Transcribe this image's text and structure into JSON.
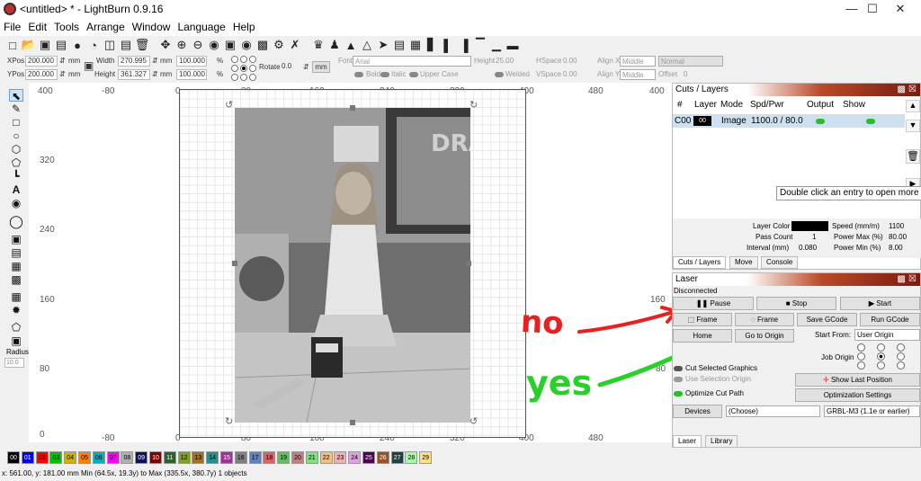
{
  "window": {
    "title": "<untitled> * - LightBurn 0.9.16",
    "minimize": "—",
    "maximize": "☐",
    "close": "✕"
  },
  "menu": [
    "File",
    "Edit",
    "Tools",
    "Arrange",
    "Window",
    "Language",
    "Help"
  ],
  "toolbar2": {
    "xpos_label": "XPos",
    "xpos": "200.000",
    "ypos_label": "YPos",
    "ypos": "200.000",
    "mm": "mm",
    "width_label": "Width",
    "width": "270.995",
    "height_label": "Height",
    "height": "361.327",
    "scale_w": "100.000",
    "scale_h": "100.000",
    "pct": "%",
    "rotate_label": "Rotate",
    "rotate": "0.0",
    "font_label": "Font",
    "font": "Arial",
    "height2_label": "Height",
    "height2": "25.00",
    "hspace_label": "HSpace",
    "hspace": "0.00",
    "vspace_label": "VSpace",
    "vspace": "0.00",
    "alignx_label": "Align X",
    "alignx": "Middle",
    "aligny_label": "Align Y",
    "aligny": "Middle",
    "normal": "Normal",
    "offset_label": "Offset",
    "offset": "0",
    "bold": "Bold",
    "italic": "Italic",
    "upper": "Upper Case",
    "welded": "Welded"
  },
  "left_tools": {
    "radius_label": "Radius:",
    "radius": "10.0"
  },
  "ruler_top": [
    "-80",
    "0",
    "80",
    "160",
    "240",
    "320",
    "400",
    "480",
    "400"
  ],
  "ruler_top_bottom": [
    "-80",
    "0",
    "80",
    "160",
    "240",
    "320",
    "400",
    "480"
  ],
  "ruler_left": [
    "400",
    "320",
    "240",
    "160",
    "80",
    "0"
  ],
  "ruler_right": [
    "400",
    "160",
    "80"
  ],
  "photo_text": "DRA",
  "color_swatches": [
    {
      "label": "00",
      "color": "#000000",
      "text": "#ffffff"
    },
    {
      "label": "01",
      "color": "#0000ff",
      "text": "#ffffff"
    },
    {
      "label": "02",
      "color": "#ff0000",
      "text": "#000000"
    },
    {
      "label": "03",
      "color": "#00c000",
      "text": "#000000"
    },
    {
      "label": "04",
      "color": "#d0b000",
      "text": "#000000"
    },
    {
      "label": "05",
      "color": "#ff8000",
      "text": "#000000"
    },
    {
      "label": "06",
      "color": "#00b0c0",
      "text": "#000000"
    },
    {
      "label": "07",
      "color": "#ff00ff",
      "text": "#000000"
    },
    {
      "label": "08",
      "color": "#b0b0b0",
      "text": "#000000"
    },
    {
      "label": "09",
      "color": "#101060",
      "text": "#ffffff"
    },
    {
      "label": "10",
      "color": "#800000",
      "text": "#ffffff"
    },
    {
      "label": "11",
      "color": "#306030",
      "text": "#ffffff"
    },
    {
      "label": "12",
      "color": "#80a020",
      "text": "#000000"
    },
    {
      "label": "13",
      "color": "#a07020",
      "text": "#000000"
    },
    {
      "label": "14",
      "color": "#209090",
      "text": "#000000"
    },
    {
      "label": "15",
      "color": "#a030a0",
      "text": "#ffffff"
    },
    {
      "label": "16",
      "color": "#808080",
      "text": "#000000"
    },
    {
      "label": "17",
      "color": "#6080c0",
      "text": "#000000"
    },
    {
      "label": "18",
      "color": "#e06060",
      "text": "#000000"
    },
    {
      "label": "19",
      "color": "#60c060",
      "text": "#000000"
    },
    {
      "label": "20",
      "color": "#c08080",
      "text": "#000000"
    },
    {
      "label": "21",
      "color": "#80e080",
      "text": "#000000"
    },
    {
      "label": "22",
      "color": "#f0c080",
      "text": "#000000"
    },
    {
      "label": "23",
      "color": "#f0b0b0",
      "text": "#000000"
    },
    {
      "label": "24",
      "color": "#e0a0e0",
      "text": "#000000"
    },
    {
      "label": "25",
      "color": "#500050",
      "text": "#ffffff"
    },
    {
      "label": "26",
      "color": "#a05020",
      "text": "#ffffff"
    },
    {
      "label": "27",
      "color": "#204040",
      "text": "#ffffff"
    },
    {
      "label": "28",
      "color": "#a0ffa0",
      "text": "#000000"
    },
    {
      "label": "29",
      "color": "#ffe080",
      "text": "#000000"
    }
  ],
  "status": {
    "text": "x: 561.00, y: 181.00 mm    Min (64.5x, 19.3y) to Max (335.5x, 380.7y)  1 objects"
  },
  "cuts": {
    "title": "Cuts / Layers",
    "headers": [
      "#",
      "Layer",
      "Mode",
      "Spd/Pwr",
      "Output",
      "Show"
    ],
    "row": {
      "num": "C00",
      "layer": "00",
      "mode": "Image",
      "spdpwr": "1100.0 / 80.0"
    },
    "tooltip": "Double click an entry to open more",
    "layer_color_label": "Layer Color",
    "speed_label": "Speed (mm/m)",
    "speed": "1100",
    "pass_label": "Pass Count",
    "pass": "1",
    "pmax_label": "Power Max (%)",
    "pmax": "80.00",
    "interval_label": "Interval (mm)",
    "interval": "0.080",
    "pmin_label": "Power Min (%)",
    "pmin": "8.00",
    "tabs": [
      "Cuts / Layers",
      "Move",
      "Console"
    ]
  },
  "laser": {
    "title": "Laser",
    "status": "Disconnected",
    "pause": "Pause",
    "stop": "Stop",
    "start": "Start",
    "frame1": "Frame",
    "frame2": "Frame",
    "save_gcode": "Save GCode",
    "run_gcode": "Run GCode",
    "home": "Home",
    "go_origin": "Go to Origin",
    "start_from_label": "Start From:",
    "start_from": "User Origin",
    "job_origin_label": "Job Origin",
    "cut_selected": "Cut Selected Graphics",
    "use_selection": "Use Selection Origin",
    "optimize_cut": "Optimize Cut Path",
    "show_last": "Show Last Position",
    "opt_settings": "Optimization Settings",
    "devices": "Devices",
    "choose": "(Choose)",
    "grbl": "GRBL-M3 (1.1e or earlier)",
    "tabs": [
      "Laser",
      "Library"
    ]
  },
  "annotations": {
    "no": "no",
    "yes": "yes",
    "no_color": "#e82020",
    "yes_color": "#28d028"
  }
}
